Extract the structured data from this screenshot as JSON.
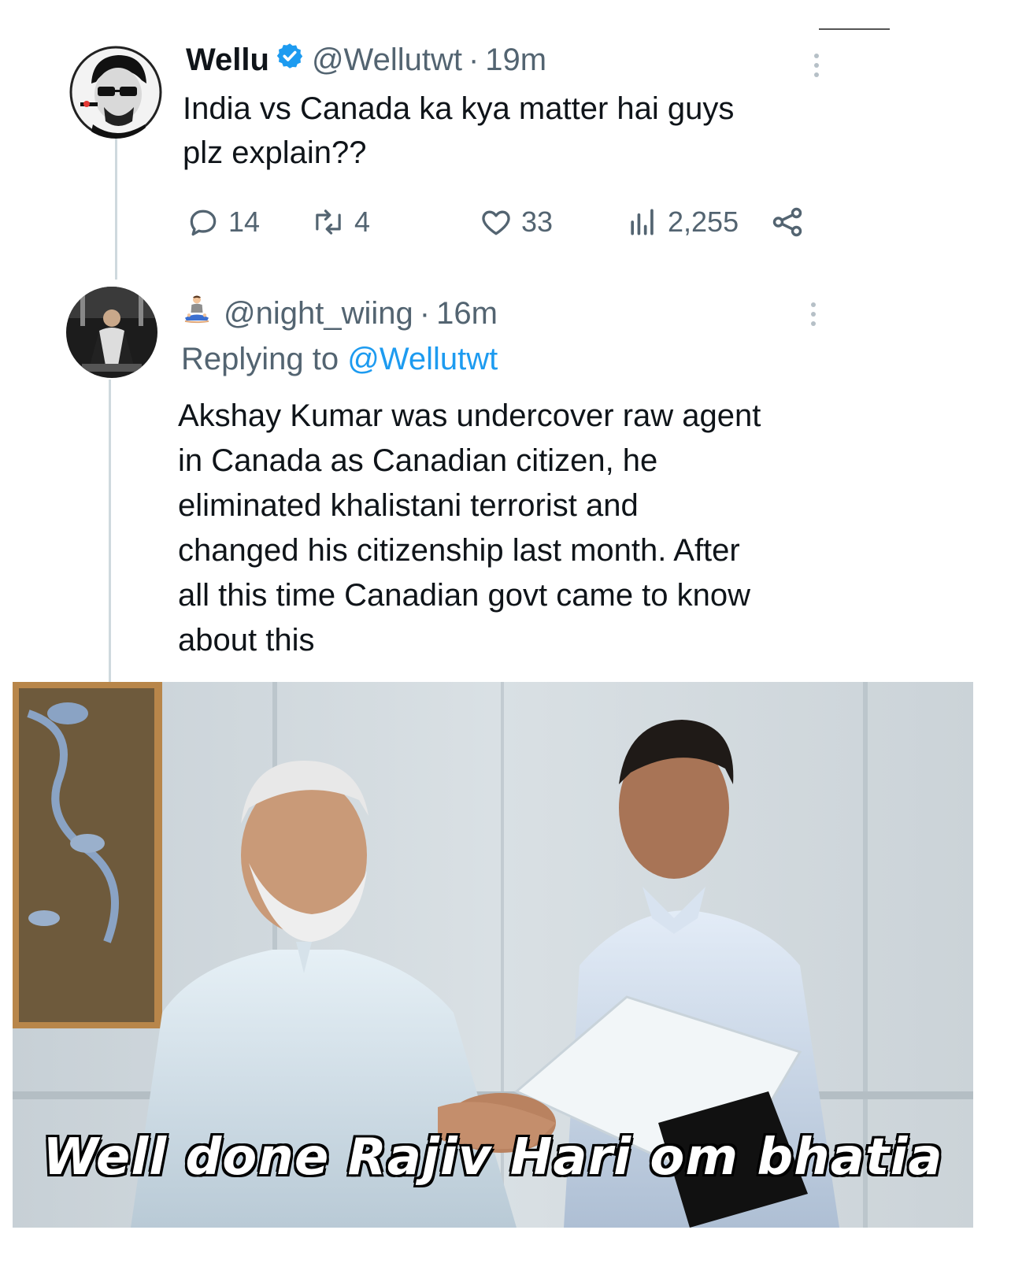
{
  "tweet1": {
    "name": "Wellu",
    "handle": "@Wellutwt",
    "separator": "·",
    "time": "19m",
    "text": "India vs Canada ka kya matter hai guys\nplz explain??",
    "replies": "14",
    "retweets": "4",
    "likes": "33",
    "views": "2,255"
  },
  "tweet2": {
    "handle": "@night_wiing",
    "separator": "·",
    "time": "16m",
    "replying_label": "Replying to",
    "replying_handle": "@Wellutwt",
    "text": "Akshay Kumar was undercover raw agent\nin Canada as Canadian citizen, he\neliminated khalistani terrorist and\nchanged his citizenship last month. After\nall this time Canadian govt came to know\nabout this"
  },
  "meme": {
    "caption": "Well done Rajiv Hari om bhatia"
  },
  "colors": {
    "verified": "#1d9bf0",
    "link": "#1d9bf0",
    "muted": "#536471"
  },
  "icons": [
    "verified-badge-icon",
    "reply-icon",
    "retweet-icon",
    "like-icon",
    "views-icon",
    "share-icon",
    "more-icon",
    "meditation-emoji-icon"
  ]
}
